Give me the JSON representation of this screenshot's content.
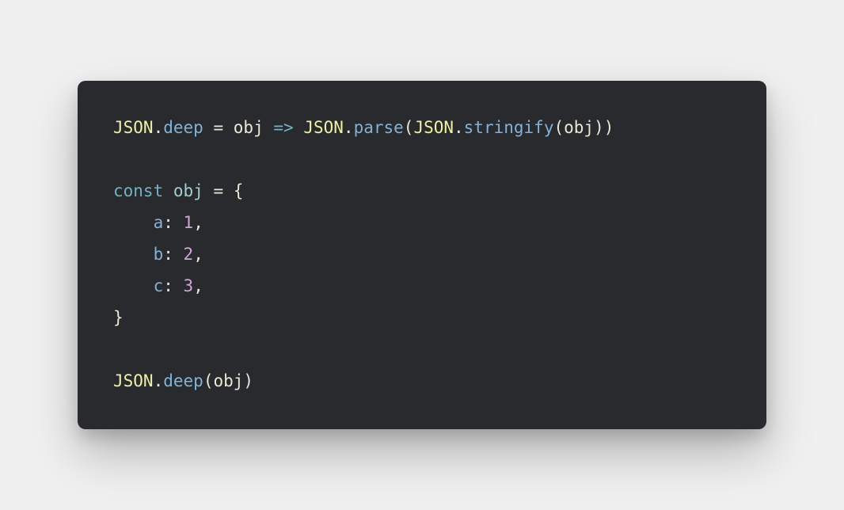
{
  "code": {
    "tokens": [
      [
        {
          "t": "JSON",
          "c": "tok-class"
        },
        {
          "t": ".",
          "c": "tok-punct"
        },
        {
          "t": "deep",
          "c": "tok-prop"
        },
        {
          "t": " ",
          "c": ""
        },
        {
          "t": "=",
          "c": "tok-punct"
        },
        {
          "t": " ",
          "c": ""
        },
        {
          "t": "obj",
          "c": "tok-ident"
        },
        {
          "t": " ",
          "c": ""
        },
        {
          "t": "=>",
          "c": "tok-arrow"
        },
        {
          "t": " ",
          "c": ""
        },
        {
          "t": "JSON",
          "c": "tok-class"
        },
        {
          "t": ".",
          "c": "tok-punct"
        },
        {
          "t": "parse",
          "c": "tok-prop"
        },
        {
          "t": "(",
          "c": "tok-punct"
        },
        {
          "t": "JSON",
          "c": "tok-class"
        },
        {
          "t": ".",
          "c": "tok-punct"
        },
        {
          "t": "stringify",
          "c": "tok-prop"
        },
        {
          "t": "(",
          "c": "tok-punct"
        },
        {
          "t": "obj",
          "c": "tok-ident"
        },
        {
          "t": ")",
          "c": "tok-punct"
        },
        {
          "t": ")",
          "c": "tok-punct"
        }
      ],
      [],
      [
        {
          "t": "const",
          "c": "tok-keyword"
        },
        {
          "t": " ",
          "c": ""
        },
        {
          "t": "obj",
          "c": "tok-objname"
        },
        {
          "t": " ",
          "c": ""
        },
        {
          "t": "=",
          "c": "tok-punct"
        },
        {
          "t": " ",
          "c": ""
        },
        {
          "t": "{",
          "c": "tok-punct"
        }
      ],
      [
        {
          "t": "    ",
          "c": ""
        },
        {
          "t": "a",
          "c": "tok-key"
        },
        {
          "t": ":",
          "c": "tok-punct"
        },
        {
          "t": " ",
          "c": ""
        },
        {
          "t": "1",
          "c": "tok-number"
        },
        {
          "t": ",",
          "c": "tok-punct"
        }
      ],
      [
        {
          "t": "    ",
          "c": ""
        },
        {
          "t": "b",
          "c": "tok-key"
        },
        {
          "t": ":",
          "c": "tok-punct"
        },
        {
          "t": " ",
          "c": ""
        },
        {
          "t": "2",
          "c": "tok-number"
        },
        {
          "t": ",",
          "c": "tok-punct"
        }
      ],
      [
        {
          "t": "    ",
          "c": ""
        },
        {
          "t": "c",
          "c": "tok-key"
        },
        {
          "t": ":",
          "c": "tok-punct"
        },
        {
          "t": " ",
          "c": ""
        },
        {
          "t": "3",
          "c": "tok-number"
        },
        {
          "t": ",",
          "c": "tok-punct"
        }
      ],
      [
        {
          "t": "}",
          "c": "tok-punct"
        }
      ],
      [],
      [
        {
          "t": "JSON",
          "c": "tok-class"
        },
        {
          "t": ".",
          "c": "tok-punct"
        },
        {
          "t": "deep",
          "c": "tok-prop"
        },
        {
          "t": "(",
          "c": "tok-punct"
        },
        {
          "t": "obj",
          "c": "tok-ident"
        },
        {
          "t": ")",
          "c": "tok-punct"
        }
      ]
    ]
  }
}
